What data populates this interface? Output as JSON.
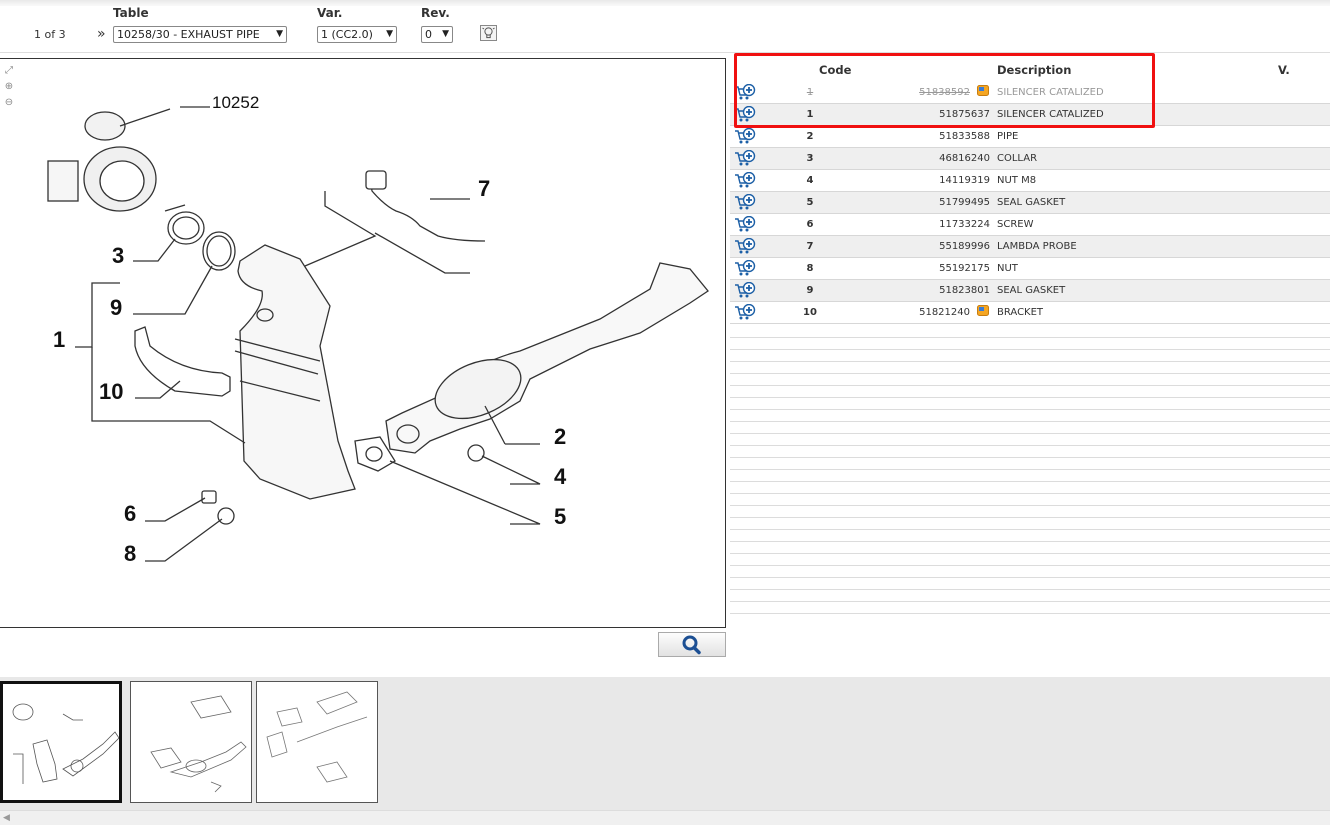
{
  "header": {
    "table_label": "Table",
    "var_label": "Var.",
    "rev_label": "Rev.",
    "pager": "1 of 3",
    "table_value": "10258/30 - EXHAUST PIPE",
    "var_value": "1 (CC2.0)",
    "rev_value": "0"
  },
  "columns": {
    "code": "Code",
    "description": "Description",
    "version": "V."
  },
  "drawing_labels": {
    "l10252": "10252",
    "l7": "7",
    "l3": "3",
    "l9": "9",
    "l1": "1",
    "l10": "10",
    "l2": "2",
    "l4": "4",
    "l5": "5",
    "l6": "6",
    "l8": "8"
  },
  "parts": [
    {
      "ref": "1",
      "code": "51838592",
      "description": "SILENCER CATALIZED",
      "obsolete": true,
      "info": true
    },
    {
      "ref": "1",
      "code": "51875637",
      "description": "SILENCER CATALIZED",
      "obsolete": false,
      "info": false
    },
    {
      "ref": "2",
      "code": "51833588",
      "description": "PIPE",
      "obsolete": false,
      "info": false
    },
    {
      "ref": "3",
      "code": "46816240",
      "description": "COLLAR",
      "obsolete": false,
      "info": false
    },
    {
      "ref": "4",
      "code": "14119319",
      "description": "NUT M8",
      "obsolete": false,
      "info": false
    },
    {
      "ref": "5",
      "code": "51799495",
      "description": "SEAL GASKET",
      "obsolete": false,
      "info": false
    },
    {
      "ref": "6",
      "code": "11733224",
      "description": "SCREW",
      "obsolete": false,
      "info": false
    },
    {
      "ref": "7",
      "code": "55189996",
      "description": "LAMBDA PROBE",
      "obsolete": false,
      "info": false
    },
    {
      "ref": "8",
      "code": "55192175",
      "description": "NUT",
      "obsolete": false,
      "info": false
    },
    {
      "ref": "9",
      "code": "51823801",
      "description": "SEAL GASKET",
      "obsolete": false,
      "info": false
    },
    {
      "ref": "10",
      "code": "51821240",
      "description": "BRACKET",
      "obsolete": false,
      "info": true
    }
  ],
  "icons": {
    "add_to_cart": "cart-plus-icon",
    "info": "info-icon",
    "search": "magnifier-icon",
    "bulb": "lightbulb-icon",
    "fit": "fit-to-window-icon",
    "zoom_in": "zoom-in-icon",
    "zoom_out": "zoom-out-icon"
  },
  "colors": {
    "highlight": "#f01010",
    "cart_blue": "#1c5fa6",
    "row_alt": "#efefef"
  }
}
